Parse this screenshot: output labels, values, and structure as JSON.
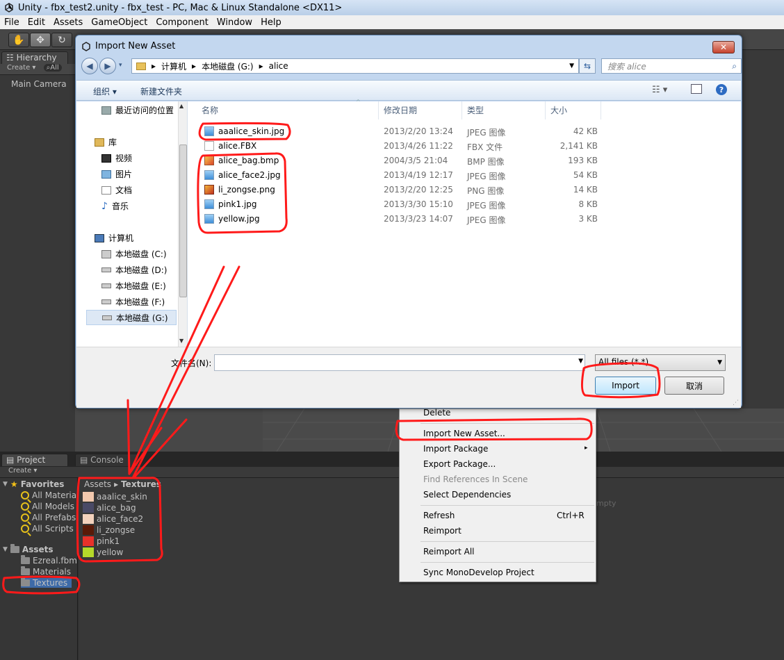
{
  "window": {
    "title": "Unity - fbx_test2.unity - fbx_test - PC, Mac & Linux Standalone <DX11>"
  },
  "menubar": [
    "File",
    "Edit",
    "Assets",
    "GameObject",
    "Component",
    "Window",
    "Help"
  ],
  "hierarchy": {
    "tab": "Hierarchy",
    "create": "Create ▾",
    "all": "All",
    "items": [
      "Main Camera"
    ]
  },
  "dialog": {
    "title": "Import New Asset",
    "close": "✕",
    "breadcrumb": [
      "计算机",
      "本地磁盘 (G:)",
      "alice"
    ],
    "search_placeholder": "搜索 alice",
    "organize": "组织 ▾",
    "new_folder": "新建文件夹",
    "nav": {
      "favorites": [
        "最近访问的位置"
      ],
      "library": "库",
      "library_items": [
        "视频",
        "图片",
        "文档",
        "音乐"
      ],
      "computer": "计算机",
      "drives": [
        "本地磁盘 (C:)",
        "本地磁盘 (D:)",
        "本地磁盘 (E:)",
        "本地磁盘 (F:)",
        "本地磁盘 (G:)"
      ]
    },
    "columns": {
      "name": "名称",
      "date": "修改日期",
      "type": "类型",
      "size": "大小"
    },
    "files": [
      {
        "name": "aaalice_skin.jpg",
        "date": "2013/2/20 13:24",
        "type": "JPEG 图像",
        "size": "42 KB",
        "icon": "jpg-icon"
      },
      {
        "name": "alice.FBX",
        "date": "2013/4/26 11:22",
        "type": "FBX 文件",
        "size": "2,141 KB",
        "icon": "fbx-file-icon"
      },
      {
        "name": "alice_bag.bmp",
        "date": "2004/3/5 21:04",
        "type": "BMP 图像",
        "size": "193 KB",
        "icon": "bmp-icon"
      },
      {
        "name": "alice_face2.jpg",
        "date": "2013/4/19 12:17",
        "type": "JPEG 图像",
        "size": "54 KB",
        "icon": "jpg-icon"
      },
      {
        "name": "li_zongse.png",
        "date": "2013/2/20 12:25",
        "type": "PNG 图像",
        "size": "14 KB",
        "icon": "png-icon"
      },
      {
        "name": "pink1.jpg",
        "date": "2013/3/30 15:10",
        "type": "JPEG 图像",
        "size": "8 KB",
        "icon": "jpg-icon"
      },
      {
        "name": "yellow.jpg",
        "date": "2013/3/23 14:07",
        "type": "JPEG 图像",
        "size": "3 KB",
        "icon": "jpg-icon"
      }
    ],
    "filename_label": "文件名(N):",
    "filename_value": "",
    "filter": "All files (*.*)",
    "import_label": "Import",
    "cancel_label": "取消"
  },
  "context_menu": {
    "items": [
      {
        "label": "Delete"
      },
      {
        "label": "Import New Asset..."
      },
      {
        "label": "Import Package",
        "submenu": "▸"
      },
      {
        "label": "Export Package..."
      },
      {
        "label": "Find References In Scene",
        "disabled": true
      },
      {
        "label": "Select Dependencies"
      },
      {
        "label": "Refresh",
        "shortcut": "Ctrl+R"
      },
      {
        "label": "Reimport"
      },
      {
        "label": "Reimport All"
      },
      {
        "label": "Sync MonoDevelop Project"
      }
    ]
  },
  "project": {
    "tabs": [
      "Project",
      "Console"
    ],
    "create": "Create ▾",
    "favorites_label": "Favorites",
    "favorites": [
      "All Materials",
      "All Models",
      "All Prefabs",
      "All Scripts"
    ],
    "assets_label": "Assets",
    "folders": [
      "Ezreal.fbm",
      "Materials",
      "Textures"
    ],
    "breadcrumb_root": "Assets",
    "breadcrumb_sep": "▸",
    "breadcrumb_current": "Textures",
    "textures": [
      {
        "name": "aaalice_skin",
        "color": "#f2c8ad"
      },
      {
        "name": "alice_bag",
        "color": "#4a4a66"
      },
      {
        "name": "alice_face2",
        "color": "#f3d2bd"
      },
      {
        "name": "li_zongse",
        "color": "#5a1a08"
      },
      {
        "name": "pink1",
        "color": "#e8322a"
      },
      {
        "name": "yellow",
        "color": "#b5d92a"
      }
    ],
    "empty_fragment": "mpty"
  },
  "colors": {
    "annotation": "#ff1a1a",
    "unity_dark": "#383838",
    "dialog_frame": "#c3d7ef"
  }
}
